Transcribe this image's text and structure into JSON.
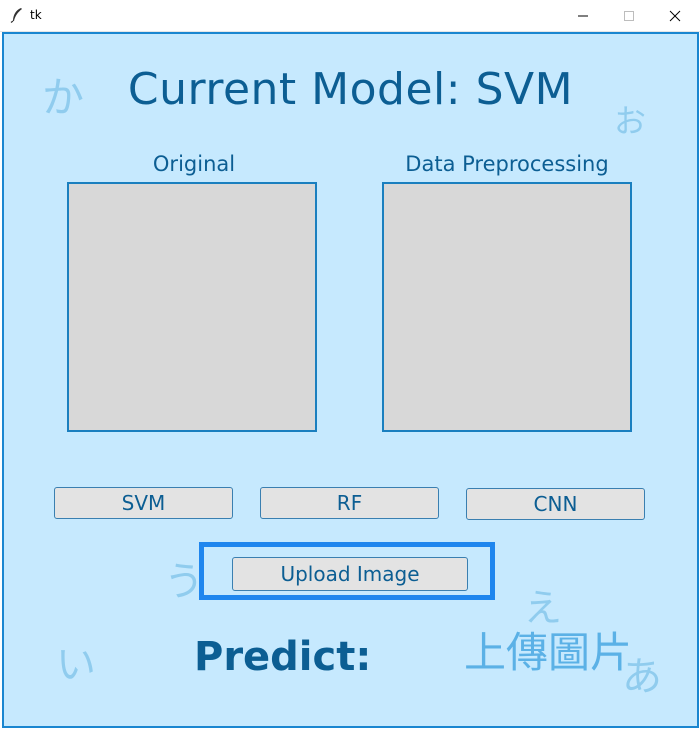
{
  "window": {
    "title": "tk"
  },
  "heading": "Current Model: SVM",
  "panels": {
    "original_label": "Original",
    "preprocessing_label": "Data Preprocessing"
  },
  "models": {
    "svm": "SVM",
    "rf": "RF",
    "cnn": "CNN"
  },
  "upload": {
    "label": "Upload Image"
  },
  "predict": {
    "label": "Predict:"
  },
  "decor": {
    "chinese": "上傳圖片",
    "ka": "か",
    "o": "お",
    "u": "う",
    "i": "い",
    "e": "え",
    "a": "あ"
  },
  "colors": {
    "background": "#c6e9fe",
    "accent": "#0c5e93",
    "frame": "#1f86ee",
    "placeholder": "#d8d8d8"
  }
}
